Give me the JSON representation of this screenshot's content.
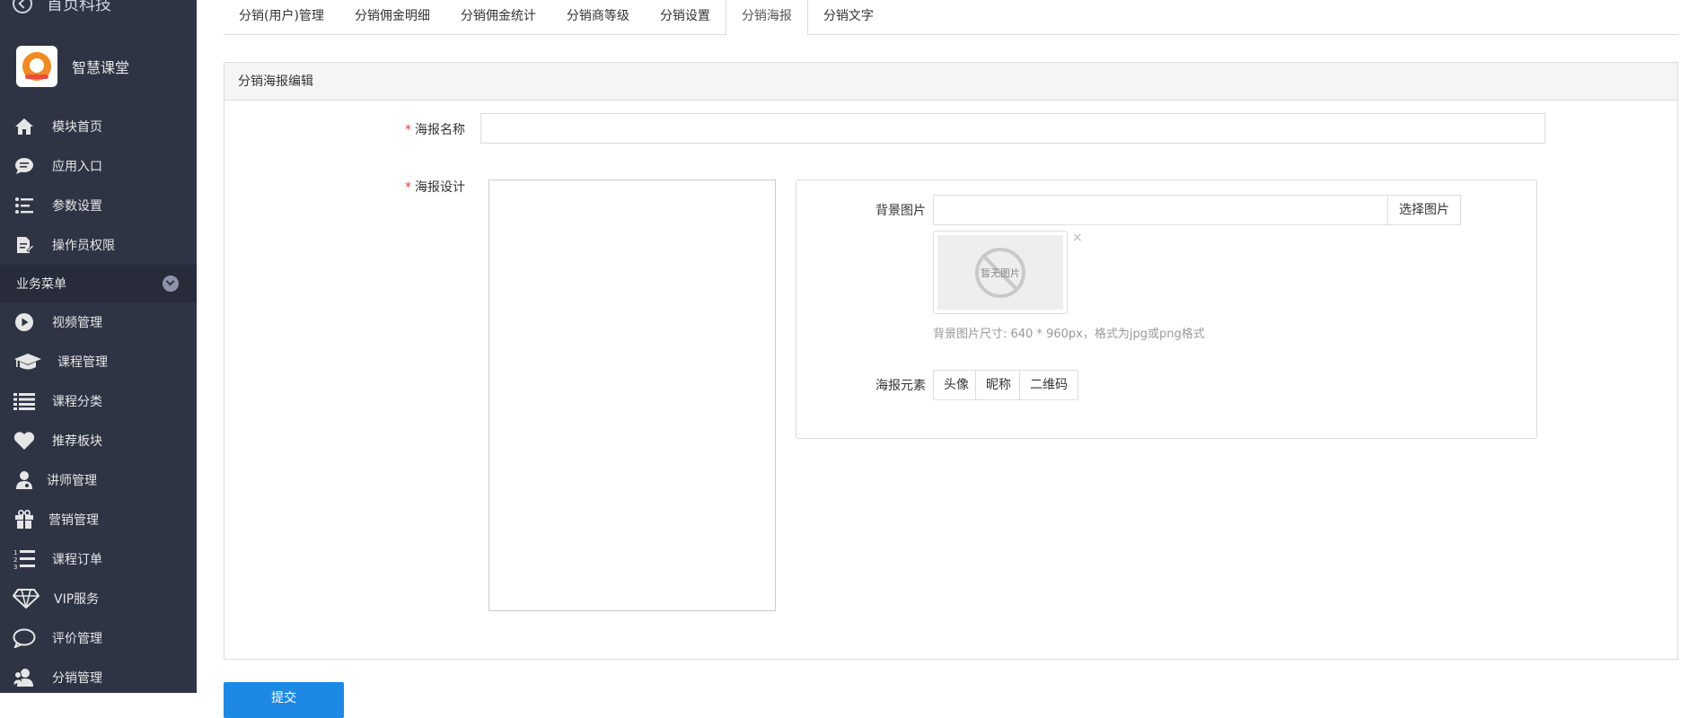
{
  "sidebar": {
    "top_title": "首页科技",
    "app_name": "智慧课堂",
    "group_label": "业务菜单",
    "top_items": [
      {
        "label": "模块首页",
        "icon": "home-icon"
      },
      {
        "label": "应用入口",
        "icon": "chat-icon"
      },
      {
        "label": "参数设置",
        "icon": "settings-list-icon"
      },
      {
        "label": "操作员权限",
        "icon": "edit-doc-icon"
      }
    ],
    "business_items": [
      {
        "label": "视频管理",
        "icon": "play-icon"
      },
      {
        "label": "课程管理",
        "icon": "graduation-cap-icon"
      },
      {
        "label": "课程分类",
        "icon": "list-icon"
      },
      {
        "label": "推荐板块",
        "icon": "heart-icon"
      },
      {
        "label": "讲师管理",
        "icon": "doctor-icon"
      },
      {
        "label": "营销管理",
        "icon": "gift-icon"
      },
      {
        "label": "课程订单",
        "icon": "ordered-list-icon"
      },
      {
        "label": "VIP服务",
        "icon": "diamond-icon"
      },
      {
        "label": "评价管理",
        "icon": "comment-icon"
      },
      {
        "label": "分销管理",
        "icon": "users-icon"
      }
    ]
  },
  "tabs": [
    {
      "label": "分销(用户)管理",
      "active": false
    },
    {
      "label": "分销佣金明细",
      "active": false
    },
    {
      "label": "分销佣金统计",
      "active": false
    },
    {
      "label": "分销商等级",
      "active": false
    },
    {
      "label": "分销设置",
      "active": false
    },
    {
      "label": "分销海报",
      "active": true
    },
    {
      "label": "分销文字",
      "active": false
    }
  ],
  "panel": {
    "title": "分销海报编辑",
    "required_mark": "*",
    "name_label": "海报名称",
    "name_value": "",
    "design_label": "海报设计",
    "bg_label": "背景图片",
    "bg_value": "",
    "pick_button": "选择图片",
    "no_image_text": "暂无图片",
    "remove_mark": "×",
    "hint": "背景图片尺寸: 640 * 960px，格式为jpg或png格式",
    "elements_label": "海报元素",
    "element_buttons": [
      "头像",
      "昵称",
      "二维码"
    ]
  },
  "submit_label": "提交",
  "colors": {
    "sidebar_bg": "#2f3445",
    "sidebar_group_bg": "#272b3a",
    "primary": "#1e88e5",
    "required": "#e4393c"
  }
}
